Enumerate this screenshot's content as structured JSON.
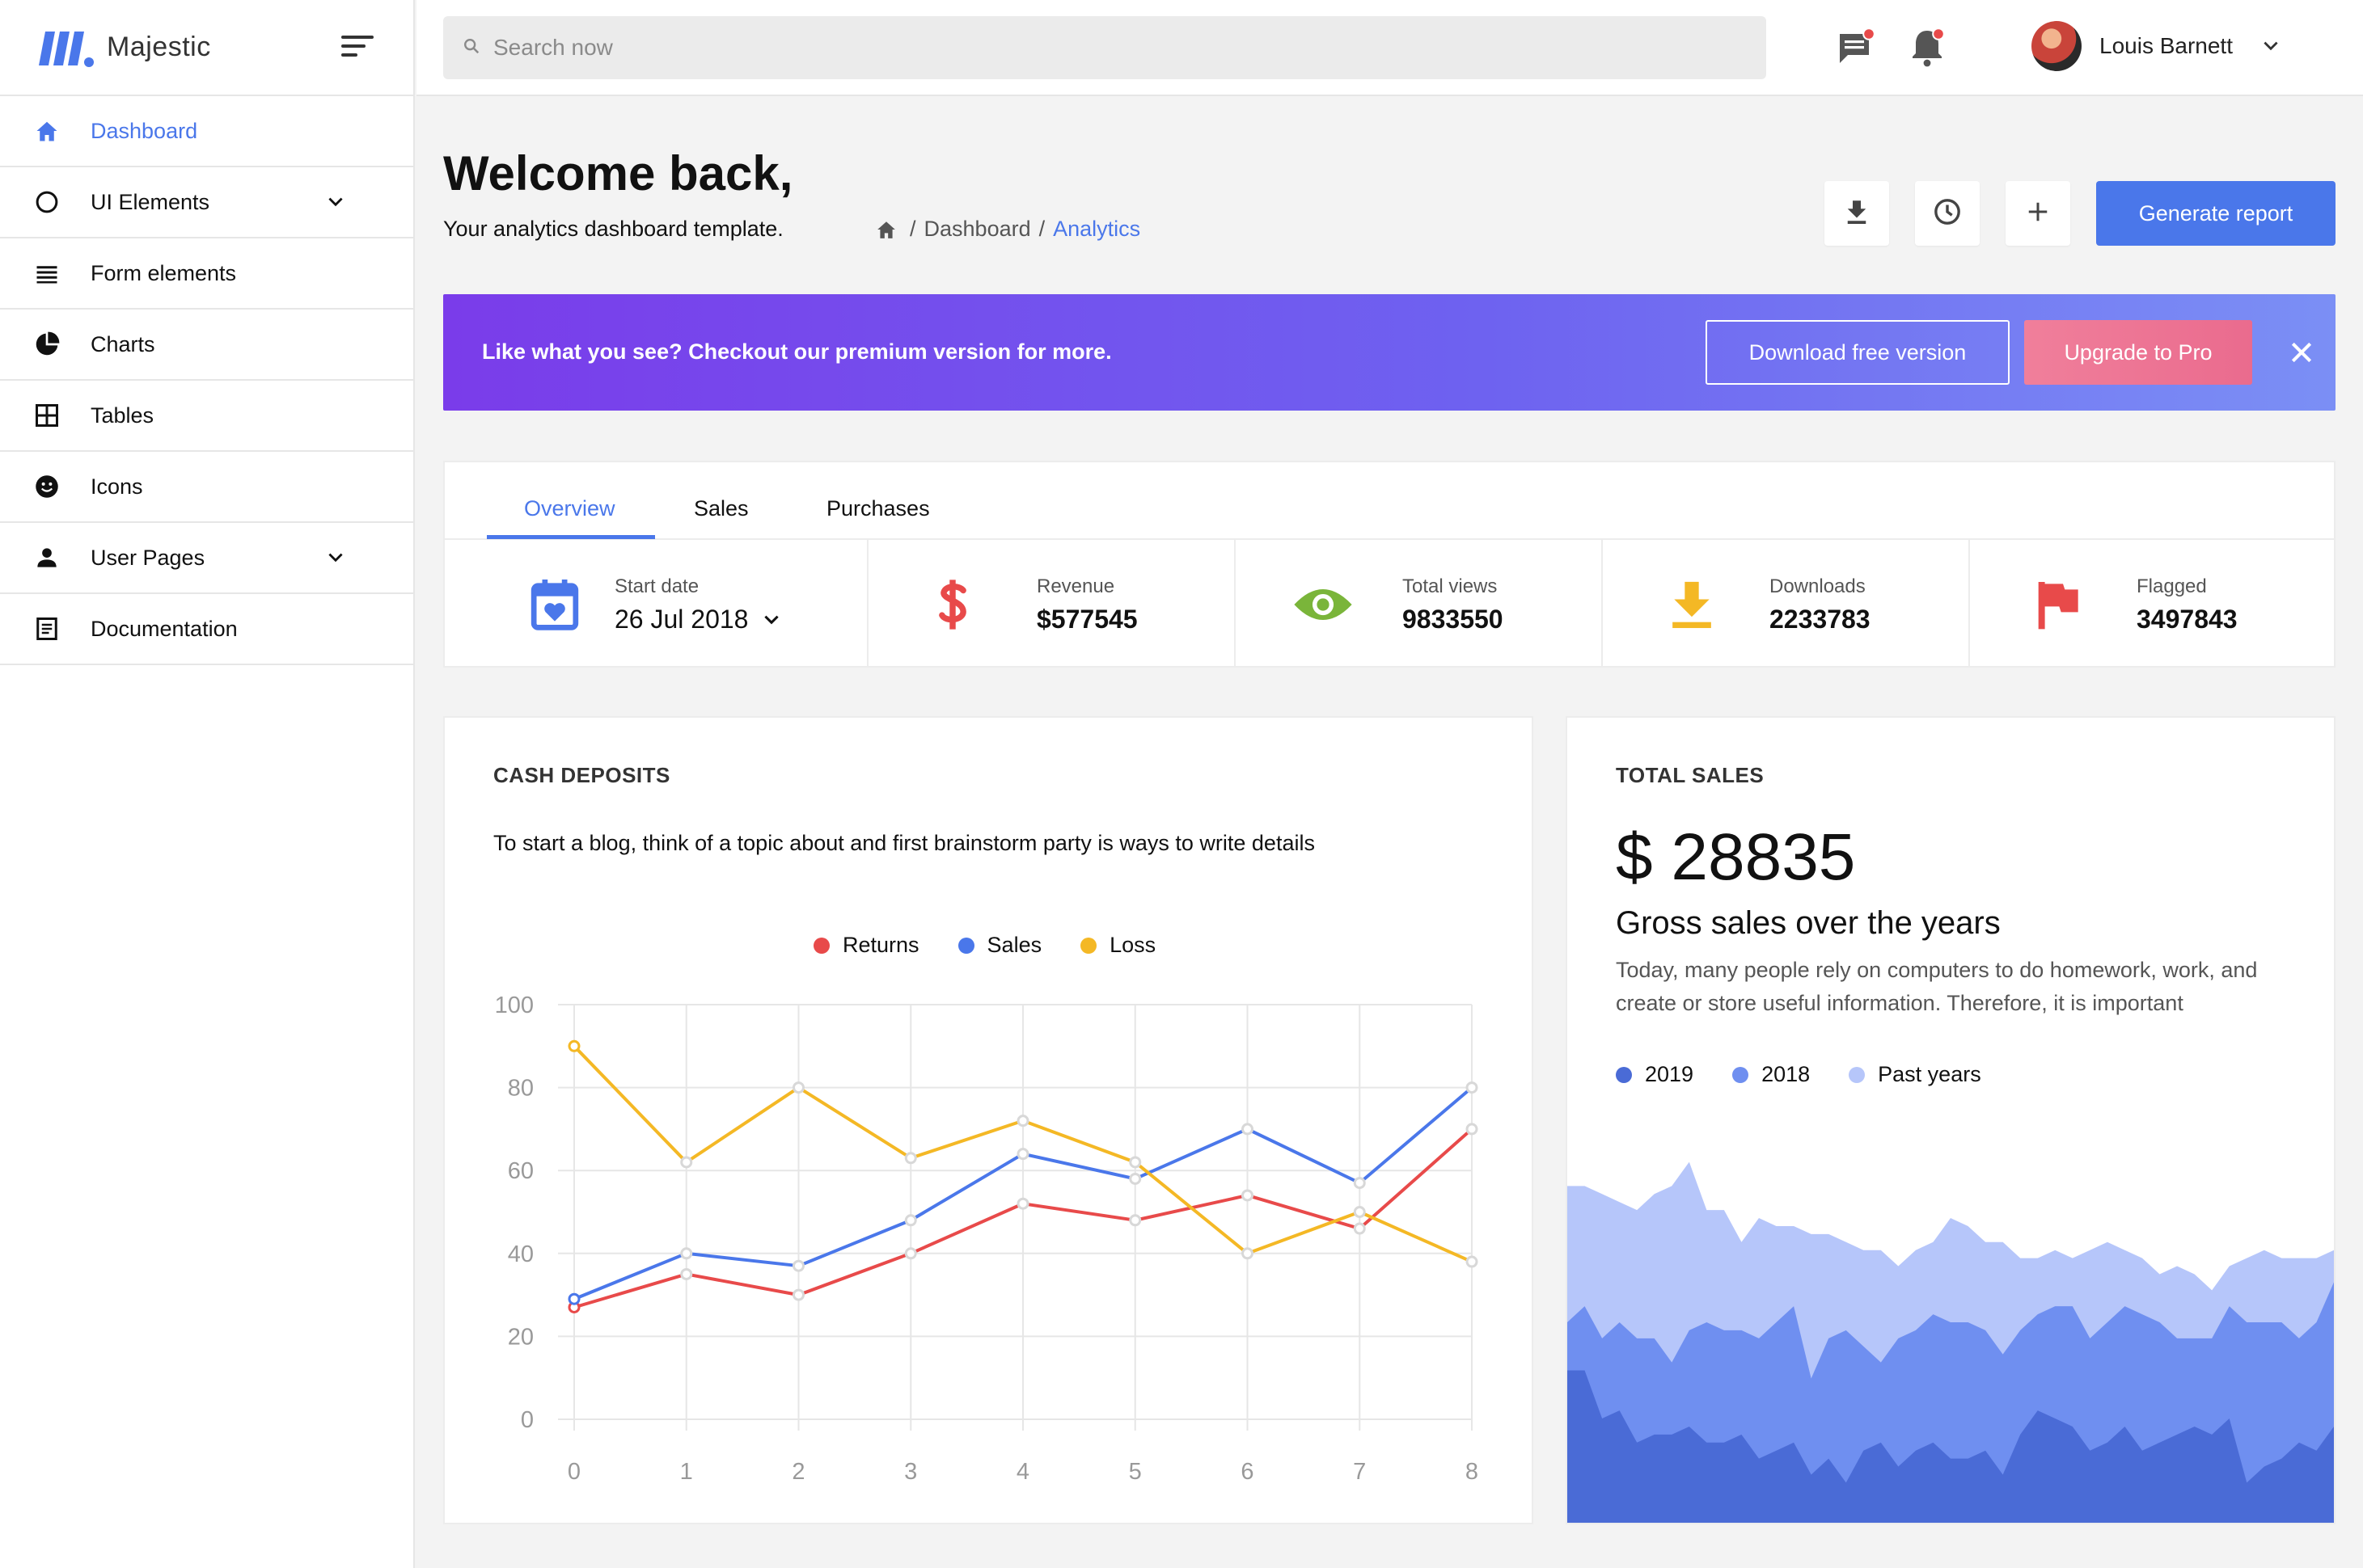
{
  "brand": {
    "name": "Majestic"
  },
  "sidebar": {
    "items": [
      {
        "label": "Dashboard",
        "icon": "home-icon",
        "active": true
      },
      {
        "label": "UI Elements",
        "icon": "circle-icon",
        "has_submenu": true
      },
      {
        "label": "Form elements",
        "icon": "list-icon"
      },
      {
        "label": "Charts",
        "icon": "pie-chart-icon"
      },
      {
        "label": "Tables",
        "icon": "grid-icon"
      },
      {
        "label": "Icons",
        "icon": "smiley-icon"
      },
      {
        "label": "User Pages",
        "icon": "user-icon",
        "has_submenu": true
      },
      {
        "label": "Documentation",
        "icon": "document-icon"
      }
    ]
  },
  "topbar": {
    "search_placeholder": "Search now",
    "user_name": "Louis Barnett"
  },
  "header": {
    "title": "Welcome back,",
    "subtitle": "Your analytics dashboard template.",
    "breadcrumb": [
      "Dashboard",
      "Analytics"
    ],
    "generate_label": "Generate report"
  },
  "banner": {
    "text": "Like what you see? Checkout our premium version for more.",
    "download_label": "Download free version",
    "upgrade_label": "Upgrade to Pro"
  },
  "stats": {
    "tabs": [
      "Overview",
      "Sales",
      "Purchases"
    ],
    "active_tab": "Overview",
    "start_date_label": "Start date",
    "start_date_value": "26 Jul 2018",
    "items": [
      {
        "label": "Revenue",
        "value": "$577545",
        "icon": "dollar-icon",
        "color": "#e84a4a"
      },
      {
        "label": "Total views",
        "value": "9833550",
        "icon": "eye-icon",
        "color": "#7ab53a"
      },
      {
        "label": "Downloads",
        "value": "2233783",
        "icon": "download-icon",
        "color": "#f4b825"
      },
      {
        "label": "Flagged",
        "value": "3497843",
        "icon": "flag-icon",
        "color": "#e84a4a"
      }
    ]
  },
  "cash_deposits": {
    "title": "CASH DEPOSITS",
    "description": "To start a blog, think of a topic about and first brainstorm party is ways to write details"
  },
  "total_sales": {
    "title": "TOTAL SALES",
    "amount": "$ 28835",
    "heading": "Gross sales over the years",
    "text": "Today, many people rely on computers to do homework, work, and create or store useful information. Therefore, it is important",
    "legend": [
      "2019",
      "2018",
      "Past years"
    ]
  },
  "colors": {
    "accent": "#4a77ea",
    "returns": "#e84a4a",
    "sales": "#4a77ea",
    "loss": "#f4b825",
    "area_2019": "#4a6bd6",
    "area_2018": "#6f8ff0",
    "area_past": "#b6c6fa"
  },
  "chart_data": [
    {
      "type": "line",
      "x": [
        0,
        1,
        2,
        3,
        4,
        5,
        6,
        7,
        8
      ],
      "ylim": [
        0,
        100
      ],
      "yticks": [
        0,
        20,
        40,
        60,
        80,
        100
      ],
      "legend_position": "top-center",
      "grid": true,
      "series": [
        {
          "name": "Returns",
          "color": "#e84a4a",
          "values": [
            27,
            35,
            30,
            40,
            52,
            48,
            54,
            46,
            70
          ]
        },
        {
          "name": "Sales",
          "color": "#4a77ea",
          "values": [
            29,
            40,
            37,
            48,
            64,
            58,
            70,
            57,
            80
          ]
        },
        {
          "name": "Loss",
          "color": "#f4b825",
          "values": [
            90,
            62,
            80,
            63,
            72,
            62,
            40,
            50,
            38
          ]
        }
      ]
    },
    {
      "type": "area",
      "stacked": true,
      "legend_position": "top-left",
      "series": [
        {
          "name": "2019",
          "color": "#4a6bd6",
          "values": [
            38,
            38,
            26,
            28,
            20,
            22,
            22,
            24,
            20,
            20,
            22,
            16,
            18,
            20,
            12,
            16,
            10,
            18,
            20,
            14,
            18,
            20,
            16,
            16,
            18,
            12,
            22,
            28,
            26,
            24,
            18,
            20,
            24,
            18,
            20,
            22,
            24,
            22,
            26,
            10,
            14,
            16,
            20,
            18,
            24
          ]
        },
        {
          "name": "2018",
          "color": "#6f8ff0",
          "values": [
            12,
            16,
            20,
            22,
            26,
            24,
            18,
            24,
            30,
            28,
            26,
            30,
            32,
            34,
            24,
            30,
            38,
            26,
            20,
            32,
            30,
            32,
            34,
            34,
            30,
            30,
            26,
            24,
            28,
            30,
            28,
            30,
            30,
            34,
            30,
            24,
            22,
            24,
            28,
            40,
            36,
            34,
            26,
            32,
            36
          ]
        },
        {
          "name": "Past years",
          "color": "#b6c6fa",
          "values": [
            34,
            30,
            36,
            30,
            32,
            36,
            44,
            42,
            28,
            30,
            22,
            30,
            24,
            20,
            36,
            26,
            22,
            24,
            28,
            18,
            20,
            18,
            26,
            24,
            22,
            28,
            18,
            14,
            14,
            12,
            22,
            20,
            14,
            14,
            12,
            18,
            16,
            12,
            10,
            16,
            18,
            16,
            20,
            16,
            8
          ]
        }
      ]
    }
  ]
}
